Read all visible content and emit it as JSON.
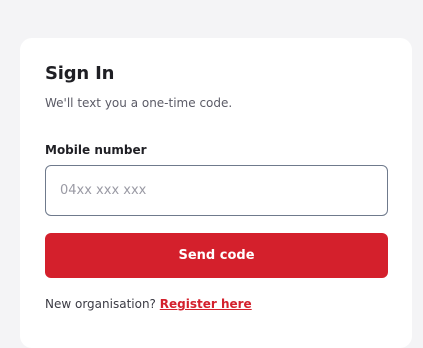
{
  "signin": {
    "title": "Sign In",
    "subtitle": "We'll text you a one-time code.",
    "mobile_label": "Mobile number",
    "mobile_placeholder": "04xx xxx xxx",
    "mobile_value": "",
    "send_label": "Send code",
    "footer_text": "New organisation?",
    "register_link": "Register here"
  },
  "colors": {
    "accent": "#d4202c",
    "background": "#f4f4f6",
    "card": "#ffffff"
  }
}
